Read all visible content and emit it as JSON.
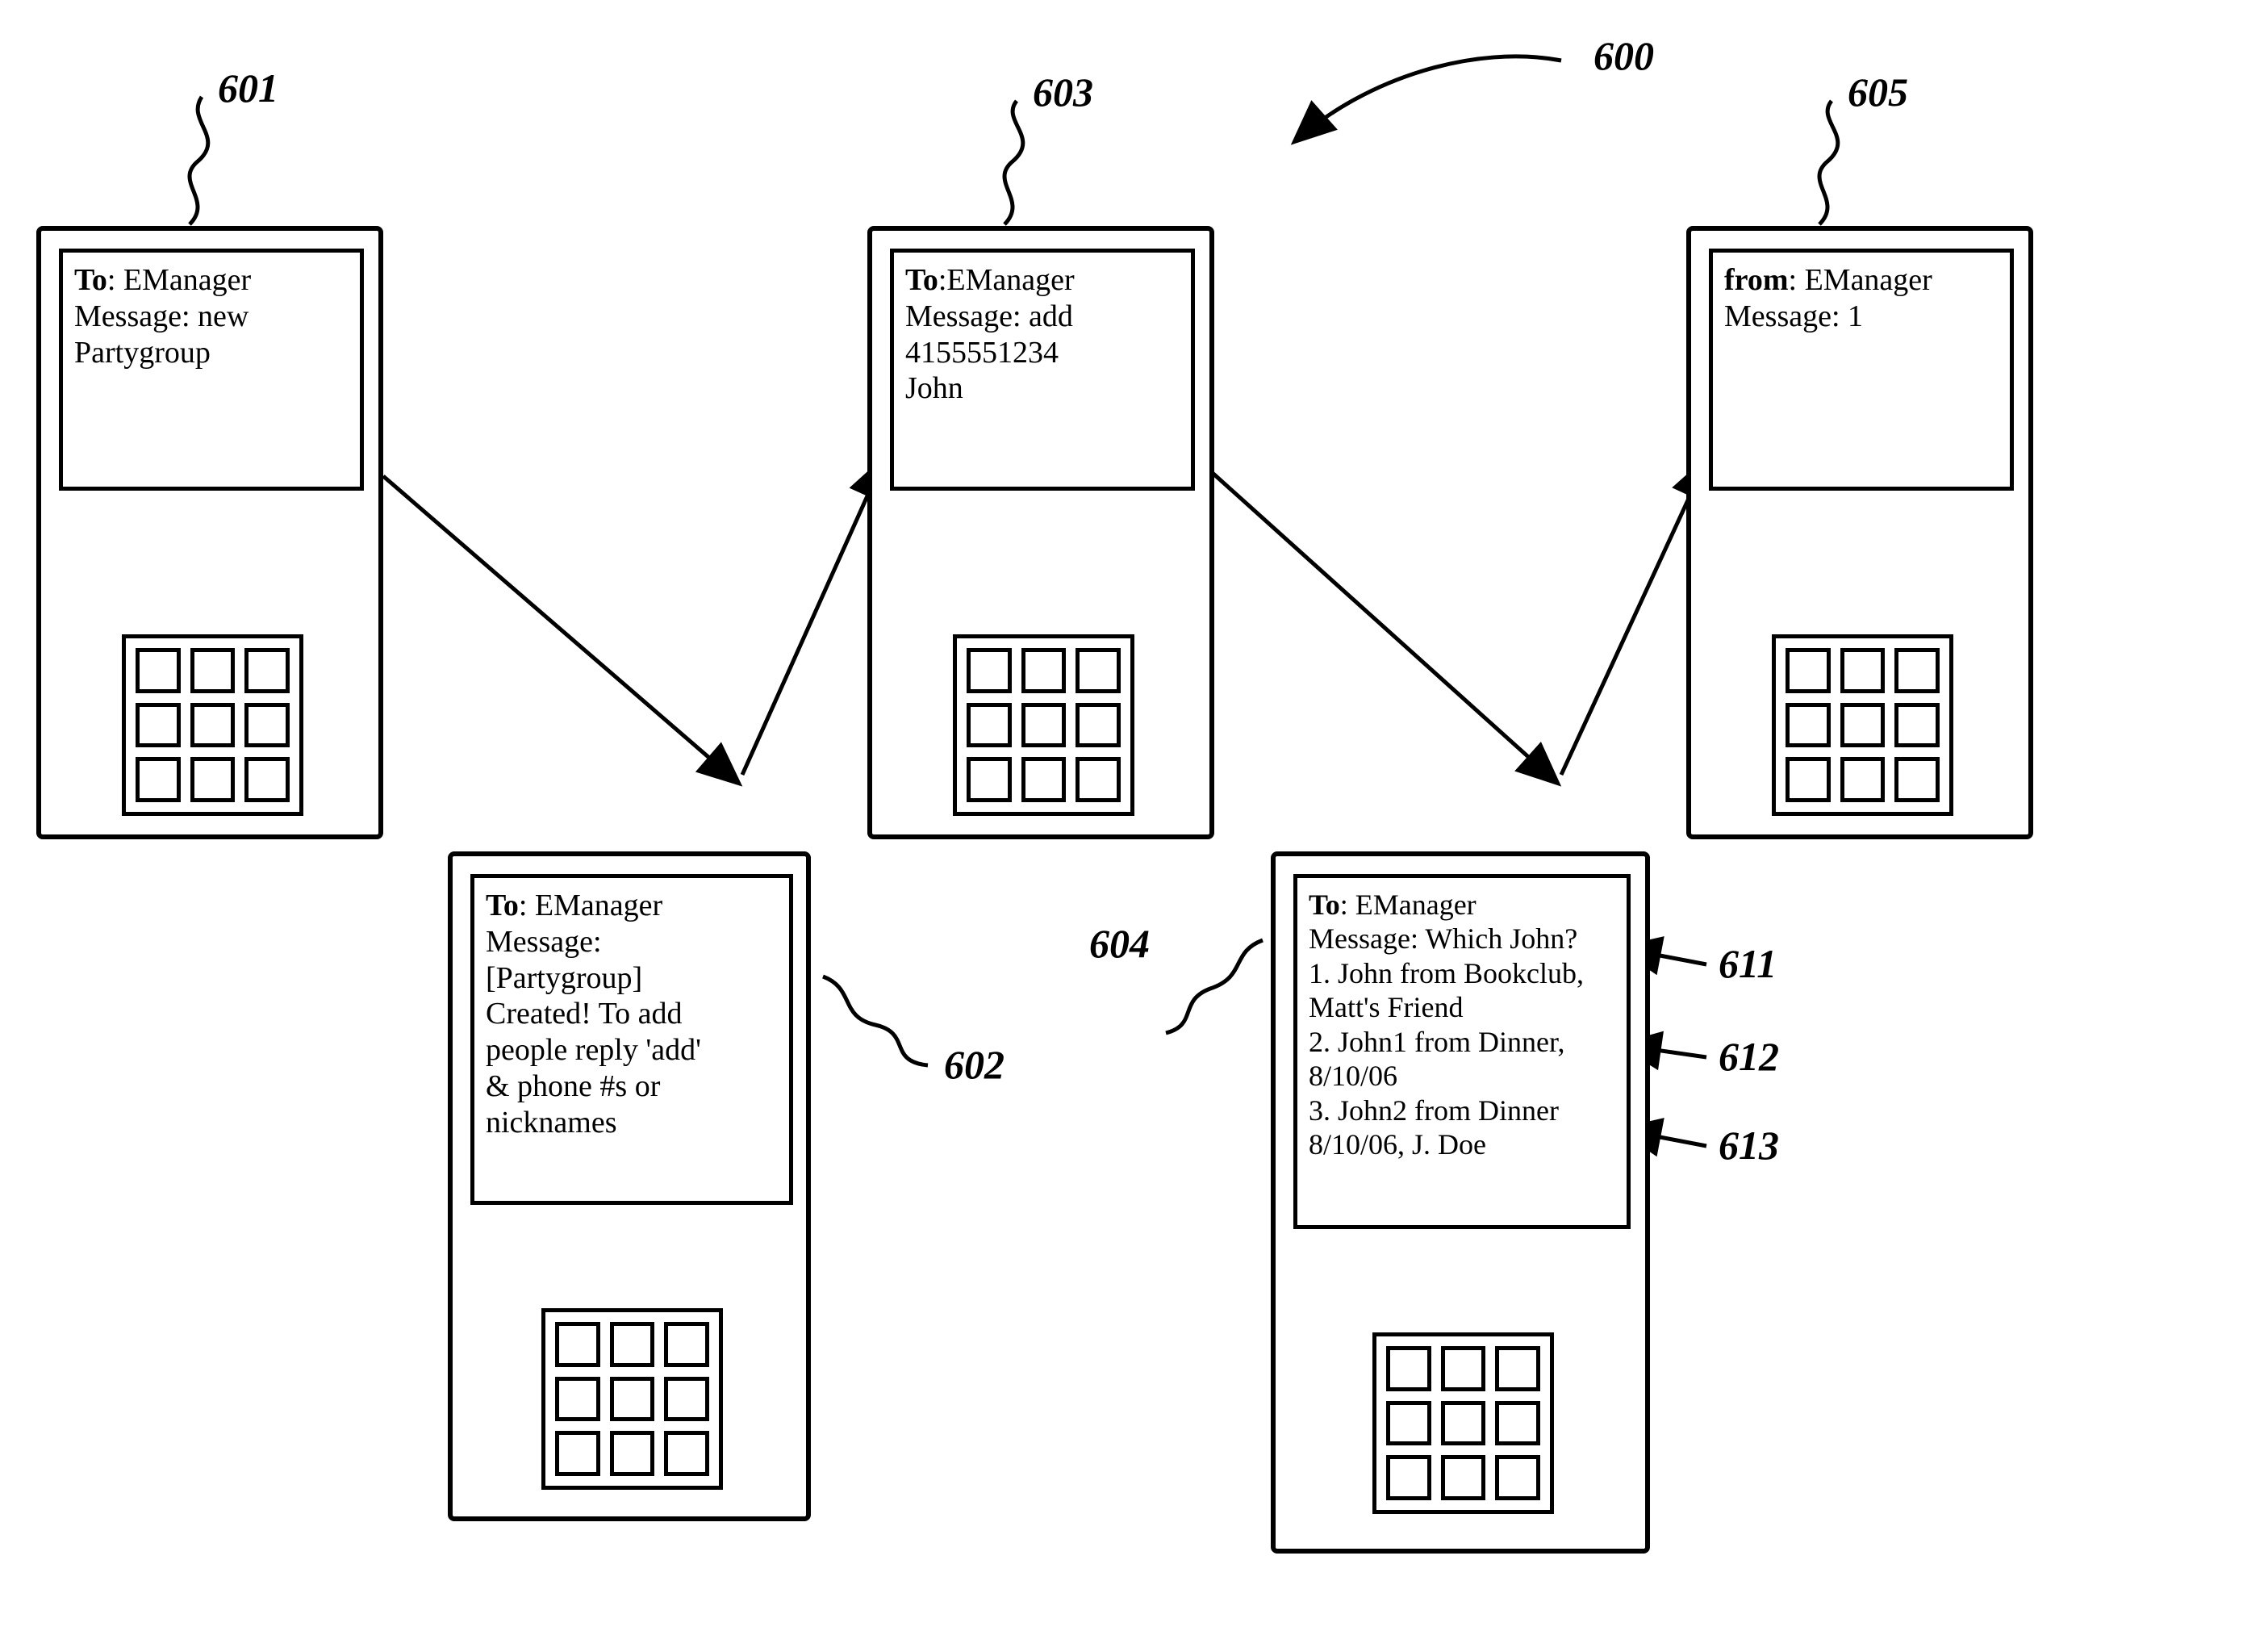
{
  "figure_label": "600",
  "phones": {
    "601": {
      "label": "601",
      "to_prefix": "To",
      "to": "EManager",
      "message_label": "Message:",
      "message": "new\nPartygroup"
    },
    "602": {
      "label": "602",
      "to_prefix": "To",
      "to": "EManager",
      "message_label": "Message:",
      "message": "[Partygroup]\nCreated! To add\npeople reply 'add'\n& phone #s or\nnicknames"
    },
    "603": {
      "label": "603",
      "to_prefix": "To",
      "to": "EManager",
      "message_label": "Message:",
      "message": "add\n4155551234\nJohn"
    },
    "604": {
      "label": "604",
      "to_prefix": "To",
      "to": "EManager",
      "message_label": "Message:",
      "question": "Which John?",
      "options": {
        "611": "1. John from Bookclub,\nMatt's Friend",
        "612": "2. John1 from Dinner,\n8/10/06",
        "613": "3. John2 from Dinner\n8/10/06, J. Doe"
      }
    },
    "605": {
      "label": "605",
      "from_prefix": "from",
      "from": "EManager",
      "message_label": "Message:",
      "message": "1"
    }
  },
  "option_labels": {
    "611": "611",
    "612": "612",
    "613": "613"
  }
}
